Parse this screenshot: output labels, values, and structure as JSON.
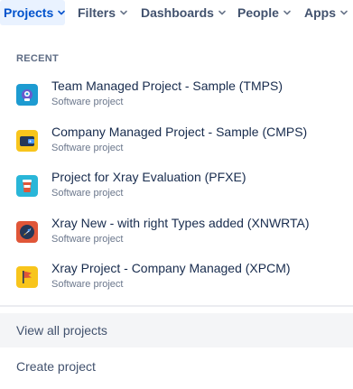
{
  "nav": {
    "items": [
      {
        "label": "Projects",
        "active": true
      },
      {
        "label": "Filters",
        "active": false
      },
      {
        "label": "Dashboards",
        "active": false
      },
      {
        "label": "People",
        "active": false
      },
      {
        "label": "Apps",
        "active": false
      }
    ]
  },
  "dropdown": {
    "section_title": "RECENT",
    "projects": [
      {
        "name": "Team Managed Project - Sample (TMPS)",
        "type": "Software project",
        "icon": "robot-icon",
        "color": "#1d9bd1"
      },
      {
        "name": "Company Managed Project - Sample (CMPS)",
        "type": "Software project",
        "icon": "wallet-icon",
        "color": "#f8c51c"
      },
      {
        "name": "Project for Xray Evaluation (PFXE)",
        "type": "Software project",
        "icon": "coffee-cup-icon",
        "color": "#29b6d8"
      },
      {
        "name": "Xray New - with right Types added (XNWRTA)",
        "type": "Software project",
        "icon": "rocket-icon",
        "color": "#e05638"
      },
      {
        "name": "Xray Project - Company Managed (XPCM)",
        "type": "Software project",
        "icon": "flag-icon",
        "color": "#f8c51c"
      }
    ],
    "view_all_label": "View all projects",
    "create_label": "Create project"
  }
}
